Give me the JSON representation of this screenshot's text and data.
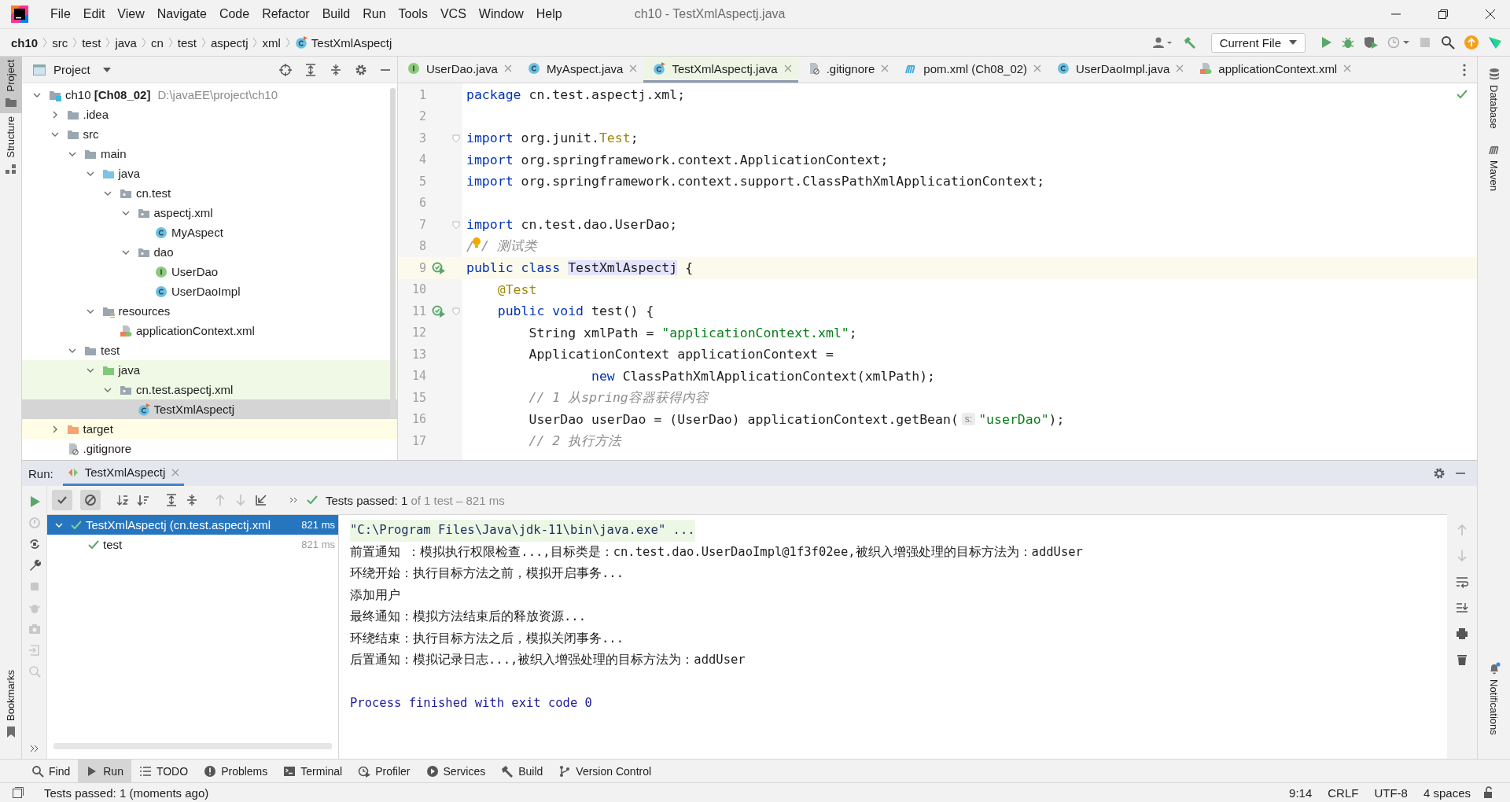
{
  "window": {
    "title": "ch10 - TestXmlAspectj.java"
  },
  "menu": [
    "File",
    "Edit",
    "View",
    "Navigate",
    "Code",
    "Refactor",
    "Build",
    "Run",
    "Tools",
    "VCS",
    "Window",
    "Help"
  ],
  "breadcrumbs": [
    {
      "kind": "project",
      "label": "ch10"
    },
    {
      "kind": "dir",
      "label": "src"
    },
    {
      "kind": "dir",
      "label": "test"
    },
    {
      "kind": "dir",
      "label": "java"
    },
    {
      "kind": "dir",
      "label": "cn"
    },
    {
      "kind": "dir",
      "label": "test"
    },
    {
      "kind": "dir",
      "label": "aspectj"
    },
    {
      "kind": "dir",
      "label": "xml"
    },
    {
      "kind": "file",
      "label": "TestXmlAspectj"
    }
  ],
  "toolbar": {
    "run_config": "Current File"
  },
  "left_stripe": [
    {
      "label": "Project",
      "kind": "project",
      "selected": true
    },
    {
      "label": "Structure",
      "kind": "structure",
      "selected": false
    },
    {
      "label": "Bookmarks",
      "kind": "bookmarks",
      "selected": false
    }
  ],
  "right_stripe": [
    {
      "label": "Database",
      "kind": "database"
    },
    {
      "label": "Maven",
      "kind": "maven"
    },
    {
      "label": "Notifications",
      "kind": "notifications"
    }
  ],
  "project_panel": {
    "title": "Project",
    "tree": [
      {
        "kind": "module",
        "label": "ch10 **[Ch08_02]**",
        "path": "D:\\javaEE\\project\\ch10",
        "expanded": true,
        "selected": false,
        "children": [
          {
            "kind": "folder",
            "label": ".idea",
            "expanded": false,
            "selected": false
          },
          {
            "kind": "folder",
            "label": "src",
            "expanded": true,
            "selected": false,
            "children": [
              {
                "kind": "folder",
                "label": "main",
                "expanded": true,
                "selected": false,
                "children": [
                  {
                    "kind": "src",
                    "label": "java",
                    "expanded": true,
                    "selected": false,
                    "children": [
                      {
                        "kind": "package",
                        "label": "cn.test",
                        "expanded": true,
                        "selected": false,
                        "children": [
                          {
                            "kind": "package",
                            "label": "aspectj.xml",
                            "expanded": true,
                            "selected": false,
                            "children": [
                              {
                                "kind": "class",
                                "label": "MyAspect",
                                "selected": false
                              }
                            ]
                          },
                          {
                            "kind": "package",
                            "label": "dao",
                            "expanded": true,
                            "selected": false,
                            "children": [
                              {
                                "kind": "interface",
                                "label": "UserDao",
                                "selected": false
                              },
                              {
                                "kind": "class",
                                "label": "UserDaoImpl",
                                "selected": false
                              }
                            ]
                          }
                        ]
                      }
                    ]
                  },
                  {
                    "kind": "resources",
                    "label": "resources",
                    "expanded": true,
                    "selected": false,
                    "children": [
                      {
                        "kind": "springxml",
                        "label": "applicationContext.xml",
                        "selected": false
                      }
                    ]
                  }
                ]
              },
              {
                "kind": "folder",
                "label": "test",
                "expanded": true,
                "selected": false,
                "children": [
                  {
                    "kind": "testsrc",
                    "label": "java",
                    "expanded": true,
                    "selected": false,
                    "test_scope": true,
                    "children": [
                      {
                        "kind": "package",
                        "label": "cn.test.aspectj.xml",
                        "expanded": true,
                        "selected": false,
                        "test_scope": true,
                        "children": [
                          {
                            "kind": "testclass",
                            "label": "TestXmlAspectj",
                            "selected": true
                          }
                        ]
                      }
                    ]
                  }
                ]
              }
            ]
          },
          {
            "kind": "excluded",
            "label": "target",
            "expanded": false,
            "selected": false,
            "excluded": true
          },
          {
            "kind": "ignore",
            "label": ".gitignore",
            "selected": false
          }
        ]
      }
    ]
  },
  "editor": {
    "tabs": [
      {
        "kind": "interface",
        "label": "UserDao.java",
        "selected": false
      },
      {
        "kind": "class",
        "label": "MyAspect.java",
        "selected": false
      },
      {
        "kind": "testclass",
        "label": "TestXmlAspectj.java",
        "selected": true
      },
      {
        "kind": "ignore",
        "label": ".gitignore",
        "selected": false
      },
      {
        "kind": "maven",
        "label": "pom.xml (Ch08_02)",
        "selected": false
      },
      {
        "kind": "class",
        "label": "UserDaoImpl.java",
        "selected": false
      },
      {
        "kind": "springxml",
        "label": "applicationContext.xml",
        "selected": false
      }
    ],
    "lines": [
      {
        "number": "1",
        "tokens": [
          {
            "kind": "kw",
            "text": "package"
          },
          {
            "kind": "plain",
            "text": " cn.test.aspectj.xml;"
          }
        ]
      },
      {
        "number": "2"
      },
      {
        "number": "3",
        "fold": true,
        "tokens": [
          {
            "kind": "kw",
            "text": "import"
          },
          {
            "kind": "plain",
            "text": " org.junit."
          },
          {
            "kind": "ann",
            "text": "Test"
          },
          {
            "kind": "plain",
            "text": ";"
          }
        ]
      },
      {
        "number": "4",
        "tokens": [
          {
            "kind": "kw",
            "text": "import"
          },
          {
            "kind": "plain",
            "text": " org.springframework.context.ApplicationContext;"
          }
        ]
      },
      {
        "number": "5",
        "tokens": [
          {
            "kind": "kw",
            "text": "import"
          },
          {
            "kind": "plain",
            "text": " org.springframework.context.support.ClassPathXmlApplicationContext;"
          }
        ]
      },
      {
        "number": "6"
      },
      {
        "number": "7",
        "fold": true,
        "tokens": [
          {
            "kind": "kw",
            "text": "import"
          },
          {
            "kind": "plain",
            "text": " cn.test.dao.UserDao;"
          }
        ]
      },
      {
        "number": "8",
        "bulb": true,
        "tokens": [
          {
            "kind": "cmt",
            "text": "/"
          },
          {
            "kind": "cmt",
            "text": "/ 测试类"
          }
        ]
      },
      {
        "number": "9",
        "run": true,
        "current": true,
        "tokens": [
          {
            "kind": "kw",
            "text": "public class "
          },
          {
            "kind": "hl",
            "text": "TestXmlAspectj"
          },
          {
            "kind": "plain",
            "text": " {"
          }
        ]
      },
      {
        "number": "10",
        "tokens": [
          {
            "kind": "ann",
            "text": "    @Test"
          }
        ]
      },
      {
        "number": "11",
        "run": true,
        "fold": true,
        "tokens": [
          {
            "kind": "kw",
            "text": "    public void"
          },
          {
            "kind": "plain",
            "text": " test() {"
          }
        ]
      },
      {
        "number": "12",
        "tokens": [
          {
            "kind": "plain",
            "text": "        String xmlPath = "
          },
          {
            "kind": "str",
            "text": "\"applicationContext.xml\""
          },
          {
            "kind": "plain",
            "text": ";"
          }
        ]
      },
      {
        "number": "13",
        "tokens": [
          {
            "kind": "plain",
            "text": "        ApplicationContext applicationContext ="
          }
        ]
      },
      {
        "number": "14",
        "tokens": [
          {
            "kind": "kw",
            "text": "                new"
          },
          {
            "kind": "plain",
            "text": " ClassPathXmlApplicationContext(xmlPath);"
          }
        ]
      },
      {
        "number": "15",
        "tokens": [
          {
            "kind": "cmt",
            "text": "        // 1 从spring容器获得内容"
          }
        ]
      },
      {
        "number": "16",
        "tokens": [
          {
            "kind": "plain",
            "text": "        UserDao userDao = (UserDao) applicationContext.getBean("
          },
          {
            "kind": "hint",
            "text": "s:"
          },
          {
            "kind": "str",
            "text": "\"userDao\""
          },
          {
            "kind": "plain",
            "text": ");"
          }
        ]
      },
      {
        "number": "17",
        "tokens": [
          {
            "kind": "cmt",
            "text": "        // 2 执行方法"
          }
        ]
      }
    ]
  },
  "run_panel": {
    "label": "Run:",
    "tab": "TestXmlAspectj",
    "summary": {
      "status": "Tests passed: 1",
      "detail": "of 1 test – 821 ms"
    },
    "tests": [
      {
        "label": "TestXmlAspectj (cn.test.aspectj.xml",
        "time": "821 ms",
        "selected": true,
        "expanded": true,
        "children": [
          {
            "label": "test",
            "time": "821 ms",
            "selected": false
          }
        ]
      }
    ],
    "console": [
      {
        "kind": "command",
        "text": "\"C:\\Program Files\\Java\\jdk-11\\bin\\java.exe\" ..."
      },
      {
        "kind": "output",
        "text": "前置通知 ：模拟执行权限检查...,目标类是：cn.test.dao.UserDaoImpl@1f3f02ee,被织入增强处理的目标方法为：addUser"
      },
      {
        "kind": "output",
        "text": "环绕开始：执行目标方法之前，模拟开启事务..."
      },
      {
        "kind": "output",
        "text": "添加用户"
      },
      {
        "kind": "output",
        "text": "最终通知：模拟方法结束后的释放资源..."
      },
      {
        "kind": "output",
        "text": "环绕结束：执行目标方法之后，模拟关闭事务..."
      },
      {
        "kind": "output",
        "text": "后置通知：模拟记录日志...,被织入增强处理的目标方法为：addUser"
      },
      {
        "kind": "exit",
        "text": "Process finished with exit code 0"
      }
    ]
  },
  "tool_tabs": [
    {
      "kind": "search",
      "label": "Find",
      "selected": false
    },
    {
      "kind": "run",
      "label": "Run",
      "selected": true
    },
    {
      "kind": "list",
      "label": "TODO",
      "selected": false
    },
    {
      "kind": "problems",
      "label": "Problems",
      "selected": false
    },
    {
      "kind": "terminal",
      "label": "Terminal",
      "selected": false
    },
    {
      "kind": "profiler",
      "label": "Profiler",
      "selected": false
    },
    {
      "kind": "services",
      "label": "Services",
      "selected": false
    },
    {
      "kind": "build",
      "label": "Build",
      "selected": false
    },
    {
      "kind": "vcs",
      "label": "Version Control",
      "selected": false
    }
  ],
  "status_bar": {
    "message": "Tests passed: 1 (moments ago)",
    "items": [
      "9:14",
      "CRLF",
      "UTF-8",
      "4 spaces"
    ]
  }
}
